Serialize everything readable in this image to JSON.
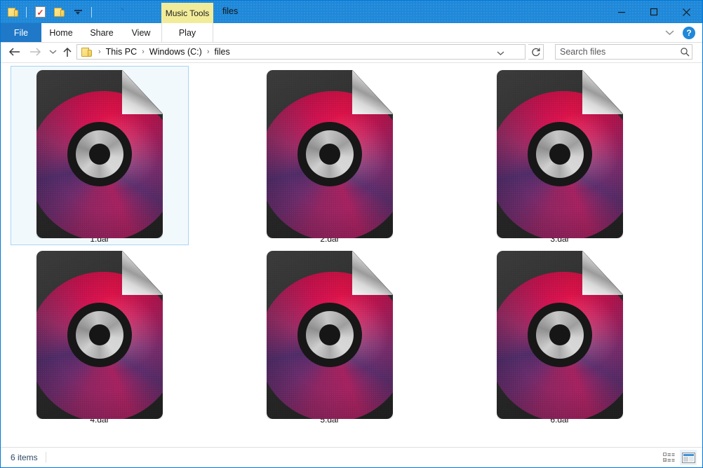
{
  "window": {
    "title": "files",
    "contextual_tab": "Music Tools",
    "controls": {
      "minimize": "minimize-button",
      "maximize": "maximize-button",
      "close": "close-button"
    }
  },
  "quick_access": {
    "items": [
      {
        "name": "folder-icon",
        "label": "Explorer"
      },
      {
        "name": "properties-icon",
        "label": "Properties"
      },
      {
        "name": "new-folder-icon",
        "label": "New folder"
      },
      {
        "name": "chevron-down-icon",
        "label": "Customize Quick Access Toolbar"
      }
    ]
  },
  "ribbon": {
    "tabs": [
      {
        "id": "file",
        "label": "File"
      },
      {
        "id": "home",
        "label": "Home"
      },
      {
        "id": "share",
        "label": "Share"
      },
      {
        "id": "view",
        "label": "View"
      },
      {
        "id": "play",
        "label": "Play"
      }
    ],
    "collapse_label": "Minimize the Ribbon",
    "help_label": "?"
  },
  "address_bar": {
    "back_label": "Back",
    "forward_label": "Forward",
    "recent_label": "Recent locations",
    "up_label": "Up",
    "breadcrumbs": [
      "This PC",
      "Windows (C:)",
      "files"
    ],
    "separator": "›",
    "refresh_label": "Refresh",
    "dropdown_label": "Previous locations"
  },
  "search": {
    "placeholder": "Search files",
    "value": ""
  },
  "files": [
    {
      "name": "1.dar",
      "selected": true,
      "type": "dar-audio-file"
    },
    {
      "name": "2.dar",
      "selected": false,
      "type": "dar-audio-file"
    },
    {
      "name": "3.dar",
      "selected": false,
      "type": "dar-audio-file"
    },
    {
      "name": "4.dar",
      "selected": false,
      "type": "dar-audio-file"
    },
    {
      "name": "5.dar",
      "selected": false,
      "type": "dar-audio-file"
    },
    {
      "name": "6.dar",
      "selected": false,
      "type": "dar-audio-file"
    }
  ],
  "status": {
    "item_count": "6 items",
    "views": [
      {
        "id": "details",
        "label": "Details view",
        "active": false
      },
      {
        "id": "large-icons",
        "label": "Large icons view",
        "active": true
      }
    ]
  },
  "colors": {
    "titlebar": "#1f88d9",
    "file_tab": "#1f78c8",
    "contextual_tab": "#f2ec9a",
    "selection_fill": "#f2f9fd",
    "selection_border": "#a8d5f2",
    "disc_magenta": "#d01050",
    "disc_purple": "#4e2a66",
    "page_dark": "#2b2b2b"
  }
}
